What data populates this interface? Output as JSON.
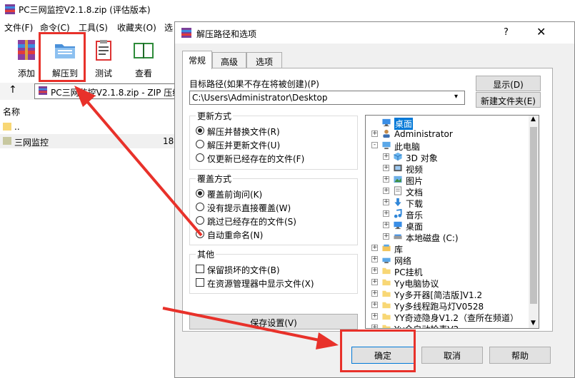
{
  "window": {
    "title": "PC三网监控V2.1.8.zip (评估版本)",
    "menu": [
      "文件(F)",
      "命令(C)",
      "工具(S)",
      "收藏夹(O)",
      "选"
    ],
    "toolbar": [
      "添加",
      "解压到",
      "测试",
      "查看"
    ],
    "address": "PC三网监控V2.1.8.zip - ZIP 压缩",
    "column_name": "名称",
    "files": [
      {
        "name": "..",
        "size": ""
      },
      {
        "name": "三网监控",
        "size": "18,"
      }
    ]
  },
  "dialog": {
    "title": "解压路径和选项",
    "help_btn": "?",
    "tabs": [
      "常规",
      "高级",
      "选项"
    ],
    "target_label": "目标路径(如果不存在将被创建)(P)",
    "target_value": "C:\\Users\\Administrator\\Desktop",
    "show_btn": "显示(D)",
    "new_folder_btn": "新建文件夹(E)",
    "update": {
      "label": "更新方式",
      "options": [
        "解压并替换文件(R)",
        "解压并更新文件(U)",
        "仅更新已经存在的文件(F)"
      ],
      "selected": 0
    },
    "overwrite": {
      "label": "覆盖方式",
      "options": [
        "覆盖前询问(K)",
        "没有提示直接覆盖(W)",
        "跳过已经存在的文件(S)",
        "自动重命名(N)"
      ],
      "selected": 0
    },
    "misc": {
      "label": "其他",
      "options": [
        "保留损坏的文件(B)",
        "在资源管理器中显示文件(X)"
      ]
    },
    "save_btn": "保存设置(V)",
    "tree": [
      {
        "label": "桌面",
        "level": 0,
        "exp": "",
        "icon": "desktop-icon",
        "selected": true
      },
      {
        "label": "Administrator",
        "level": 1,
        "exp": "+",
        "icon": "user-icon"
      },
      {
        "label": "此电脑",
        "level": 1,
        "exp": "-",
        "icon": "computer-icon"
      },
      {
        "label": "3D 对象",
        "level": 2,
        "exp": "+",
        "icon": "cube-icon"
      },
      {
        "label": "视频",
        "level": 2,
        "exp": "+",
        "icon": "video-icon"
      },
      {
        "label": "图片",
        "level": 2,
        "exp": "+",
        "icon": "picture-icon"
      },
      {
        "label": "文档",
        "level": 2,
        "exp": "+",
        "icon": "document-icon"
      },
      {
        "label": "下载",
        "level": 2,
        "exp": "+",
        "icon": "download-icon"
      },
      {
        "label": "音乐",
        "level": 2,
        "exp": "+",
        "icon": "music-icon"
      },
      {
        "label": "桌面",
        "level": 2,
        "exp": "+",
        "icon": "desktop-icon"
      },
      {
        "label": "本地磁盘 (C:)",
        "level": 2,
        "exp": "+",
        "icon": "drive-icon"
      },
      {
        "label": "库",
        "level": 1,
        "exp": "+",
        "icon": "library-icon"
      },
      {
        "label": "网络",
        "level": 1,
        "exp": "+",
        "icon": "network-icon"
      },
      {
        "label": "PC挂机",
        "level": 1,
        "exp": "+",
        "icon": "folder-icon"
      },
      {
        "label": "Yy电脑协议",
        "level": 1,
        "exp": "+",
        "icon": "folder-icon"
      },
      {
        "label": "Yy多开器[简洁版]V1.2",
        "level": 1,
        "exp": "+",
        "icon": "folder-icon"
      },
      {
        "label": "Yy多线程跑马灯V0528",
        "level": 1,
        "exp": "+",
        "icon": "folder-icon"
      },
      {
        "label": "YY奇迹隐身V1.2（查所在频道）",
        "level": 1,
        "exp": "+",
        "icon": "folder-icon"
      },
      {
        "label": "Yy全自动抢麦V2",
        "level": 1,
        "exp": "+",
        "icon": "folder-icon"
      }
    ],
    "ok_btn": "确定",
    "cancel_btn": "取消",
    "help_text_btn": "帮助"
  },
  "colors": {
    "accent": "#0078d7",
    "highlight": "#cce8ff",
    "annotation": "#e8312a",
    "folder": "#f8d775"
  }
}
